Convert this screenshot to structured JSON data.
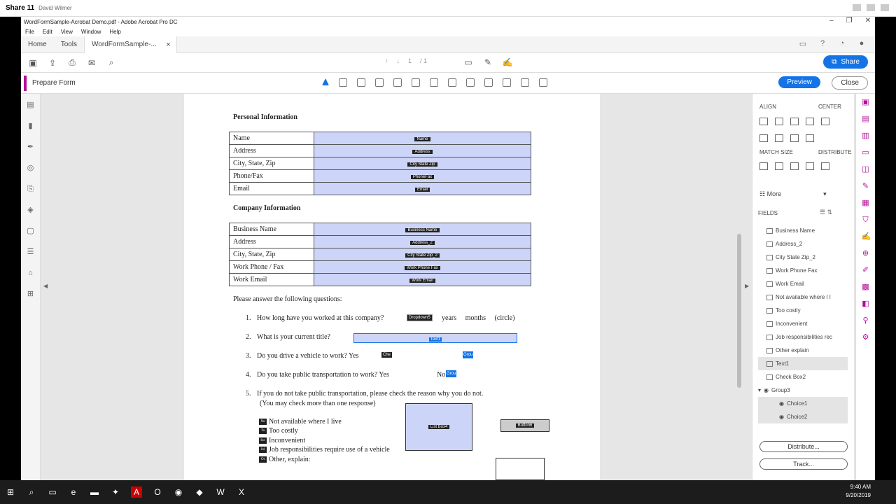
{
  "share": {
    "title": "Share 11",
    "name": "David Wilmer"
  },
  "window": {
    "title": "WordFormSample-Acrobat Demo.pdf - Adobe Acrobat Pro DC"
  },
  "menu": [
    "File",
    "Edit",
    "View",
    "Window",
    "Help"
  ],
  "tabs": {
    "home": "Home",
    "tools": "Tools",
    "doc": "WordFormSample-..."
  },
  "nav": {
    "page": "1",
    "total": "/ 1"
  },
  "share_btn": "Share",
  "prepare": {
    "label": "Prepare Form",
    "preview": "Preview",
    "close": "Close"
  },
  "doc": {
    "personal_title": "Personal Information",
    "personal": [
      {
        "label": "Name",
        "field": "Name"
      },
      {
        "label": "Address",
        "field": "Address"
      },
      {
        "label": "City, State, Zip",
        "field": "City State Zip"
      },
      {
        "label": "Phone/Fax",
        "field": "PhoneFax"
      },
      {
        "label": "Email",
        "field": "Email"
      }
    ],
    "company_title": "Company Information",
    "company": [
      {
        "label": "Business Name",
        "field": "Business Name"
      },
      {
        "label": "Address",
        "field": "Address_2"
      },
      {
        "label": "City, State, Zip",
        "field": "City State Zip_2"
      },
      {
        "label": "Work Phone / Fax",
        "field": "Work Phone  Fax"
      },
      {
        "label": "Work Email",
        "field": "Work Email"
      }
    ],
    "intro": "Please answer the following questions:",
    "q1": "How long have you worked at this company?",
    "q1_field": "Dropdown5",
    "q1_tail": "years     months     (circle)",
    "q2": "What is your current title?",
    "q2_field": "Text1",
    "q3": "Do you drive a vehicle to work?  Yes",
    "q3_field": "Che",
    "q3_grp": "Grou",
    "q4": "Do you take public transportation to work? Yes",
    "q4_no": "No",
    "q4_grp": "Grou",
    "q5": "If you do not take public transportation, please check the reason why you do not.",
    "q5b": "(You may check more than one response)",
    "n1": "1.",
    "n2": "2.",
    "n3": "3.",
    "n4": "4.",
    "n5": "5.",
    "checks": [
      {
        "tag": "No",
        "text": "Not available where I live"
      },
      {
        "tag": "To",
        "text": "Too costly"
      },
      {
        "tag": "Inc",
        "text": "Inconvenient"
      },
      {
        "tag": "Jol",
        "text": "Job responsibilities require use of a vehicle"
      },
      {
        "tag": "Ot",
        "text": "Other, explain:"
      }
    ],
    "listbox": "List Box4",
    "button6": "Button6"
  },
  "panel": {
    "align": "ALIGN",
    "center": "CENTER",
    "match": "MATCH SIZE",
    "distribute": "DISTRIBUTE",
    "more": "More",
    "fields": "FIELDS",
    "items": [
      "Business Name",
      "Address_2",
      "City State Zip_2",
      "Work Phone  Fax",
      "Work Email",
      "Not available where I l",
      "Too costly",
      "Inconvenient",
      "Job responsibilities rec",
      "Other explain",
      "Text1",
      "Check Box2",
      "Group3",
      "Choice1",
      "Choice2"
    ],
    "distribute_btn": "Distribute...",
    "track_btn": "Track..."
  },
  "clock": {
    "time": "9:40 AM",
    "date": "9/20/2019"
  }
}
